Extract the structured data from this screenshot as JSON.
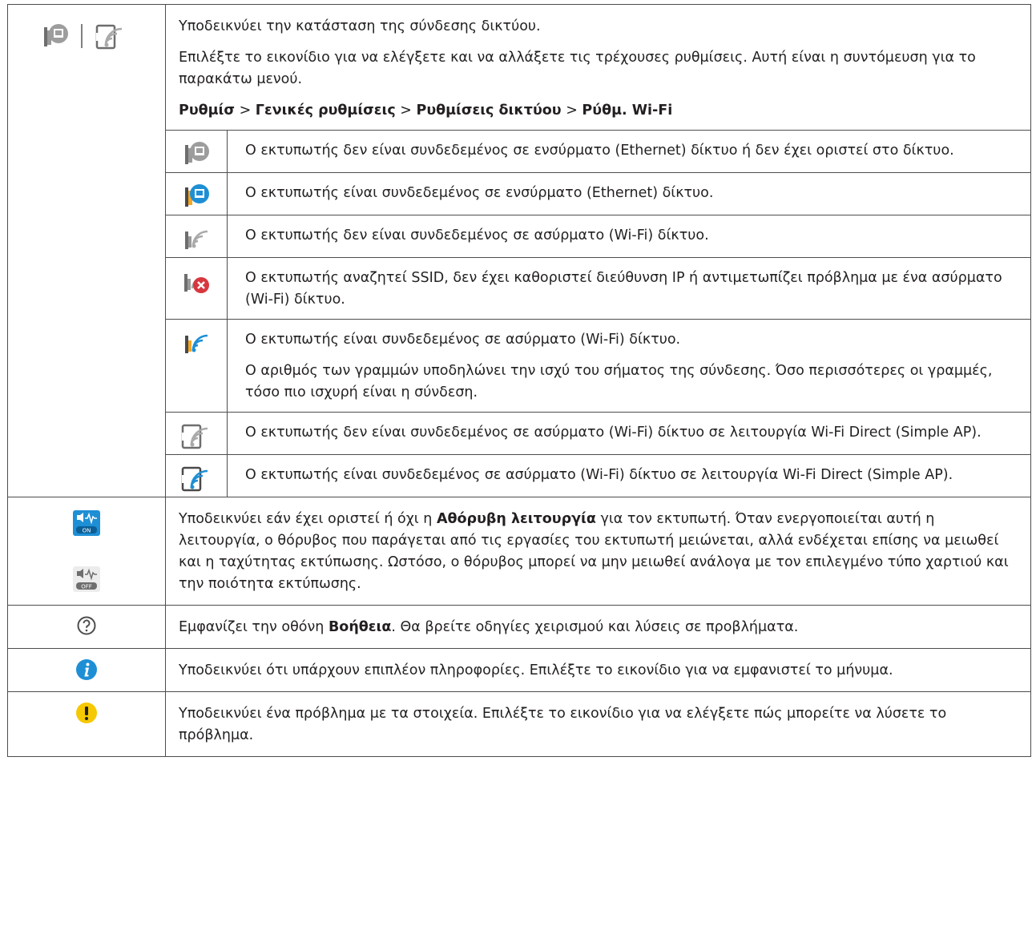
{
  "network": {
    "intro": [
      "Υποδεικνύει την κατάσταση της σύνδεσης δικτύου.",
      "Επιλέξτε το εικονίδιο για να ελέγξετε και να αλλάξετε τις τρέχουσες ρυθμίσεις. Αυτή είναι η συντόμευση για το παρακάτω μενού."
    ],
    "menu_path": {
      "p1": "Ρυθμίσ",
      "sep": " > ",
      "p2": "Γενικές ρυθμίσεις",
      "p3": "Ρυθμίσεις δικτύου",
      "p4": "Ρύθμ. Wi-Fi"
    },
    "statuses": [
      {
        "icon": "wired-disconnected-icon",
        "lines": [
          "Ο εκτυπωτής δεν είναι συνδεδεμένος σε ενσύρματο (Ethernet) δίκτυο ή δεν έχει οριστεί στο δίκτυο."
        ]
      },
      {
        "icon": "wired-connected-icon",
        "lines": [
          "Ο εκτυπωτής είναι συνδεδεμένος σε ενσύρματο (Ethernet) δίκτυο."
        ]
      },
      {
        "icon": "wifi-disconnected-icon",
        "lines": [
          "Ο εκτυπωτής δεν είναι συνδεδεμένος σε ασύρματο (Wi-Fi) δίκτυο."
        ]
      },
      {
        "icon": "wifi-error-icon",
        "lines": [
          "Ο εκτυπωτής αναζητεί SSID, δεν έχει καθοριστεί διεύθυνση IP ή αντιμετωπίζει πρόβλημα με ένα ασύρματο (Wi-Fi) δίκτυο."
        ]
      },
      {
        "icon": "wifi-connected-icon",
        "lines": [
          "Ο εκτυπωτής είναι συνδεδεμένος σε ασύρματο (Wi-Fi) δίκτυο.",
          "Ο αριθμός των γραμμών υποδηλώνει την ισχύ του σήματος της σύνδεσης. Όσο περισσότερες οι γραμμές, τόσο πιο ισχυρή είναι η σύνδεση."
        ]
      },
      {
        "icon": "wifi-direct-disconnected-icon",
        "lines": [
          "Ο εκτυπωτής δεν είναι συνδεδεμένος σε ασύρματο (Wi-Fi) δίκτυο σε λειτουργία Wi-Fi Direct (Simple AP)."
        ]
      },
      {
        "icon": "wifi-direct-connected-icon",
        "lines": [
          "Ο εκτυπωτής είναι συνδεδεμένος σε ασύρματο (Wi-Fi) δίκτυο σε λειτουργία Wi-Fi Direct (Simple AP)."
        ]
      }
    ]
  },
  "quiet": {
    "icon_on_label": "ON",
    "icon_off_label": "OFF",
    "t1": "Υποδεικνύει εάν έχει οριστεί ή όχι η ",
    "bold": "Αθόρυβη λειτουργία",
    "t2": " για τον εκτυπωτή. Όταν ενεργοποιείται αυτή η λειτουργία, ο θόρυβος που παράγεται από τις εργασίες του εκτυπωτή μειώνεται, αλλά ενδέχεται επίσης να μειωθεί και η ταχύτητας εκτύπωσης. Ωστόσο, ο θόρυβος μπορεί να μην μειωθεί ανάλογα με τον επιλεγμένο τύπο χαρτιού και την ποιότητα εκτύπωσης."
  },
  "help": {
    "t1": "Εμφανίζει την οθόνη ",
    "bold": "Βοήθεια",
    "t2": ". Θα βρείτε οδηγίες χειρισμού και λύσεις σε προβλήματα."
  },
  "info": {
    "text": "Υποδεικνύει ότι υπάρχουν επιπλέον πληροφορίες. Επιλέξτε το εικονίδιο για να εμφανιστεί το μήνυμα."
  },
  "warning": {
    "text": "Υποδεικνύει ένα πρόβλημα με τα στοιχεία. Επιλέξτε το εικονίδιο για να ελέγξετε πώς μπορείτε να λύσετε το πρόβλημα."
  },
  "colors": {
    "accent_blue": "#1e8fd5",
    "error_red": "#d7373f",
    "warning_yellow": "#f6c800",
    "icon_gray": "#8a8a8a",
    "border": "#4d4d4d"
  }
}
